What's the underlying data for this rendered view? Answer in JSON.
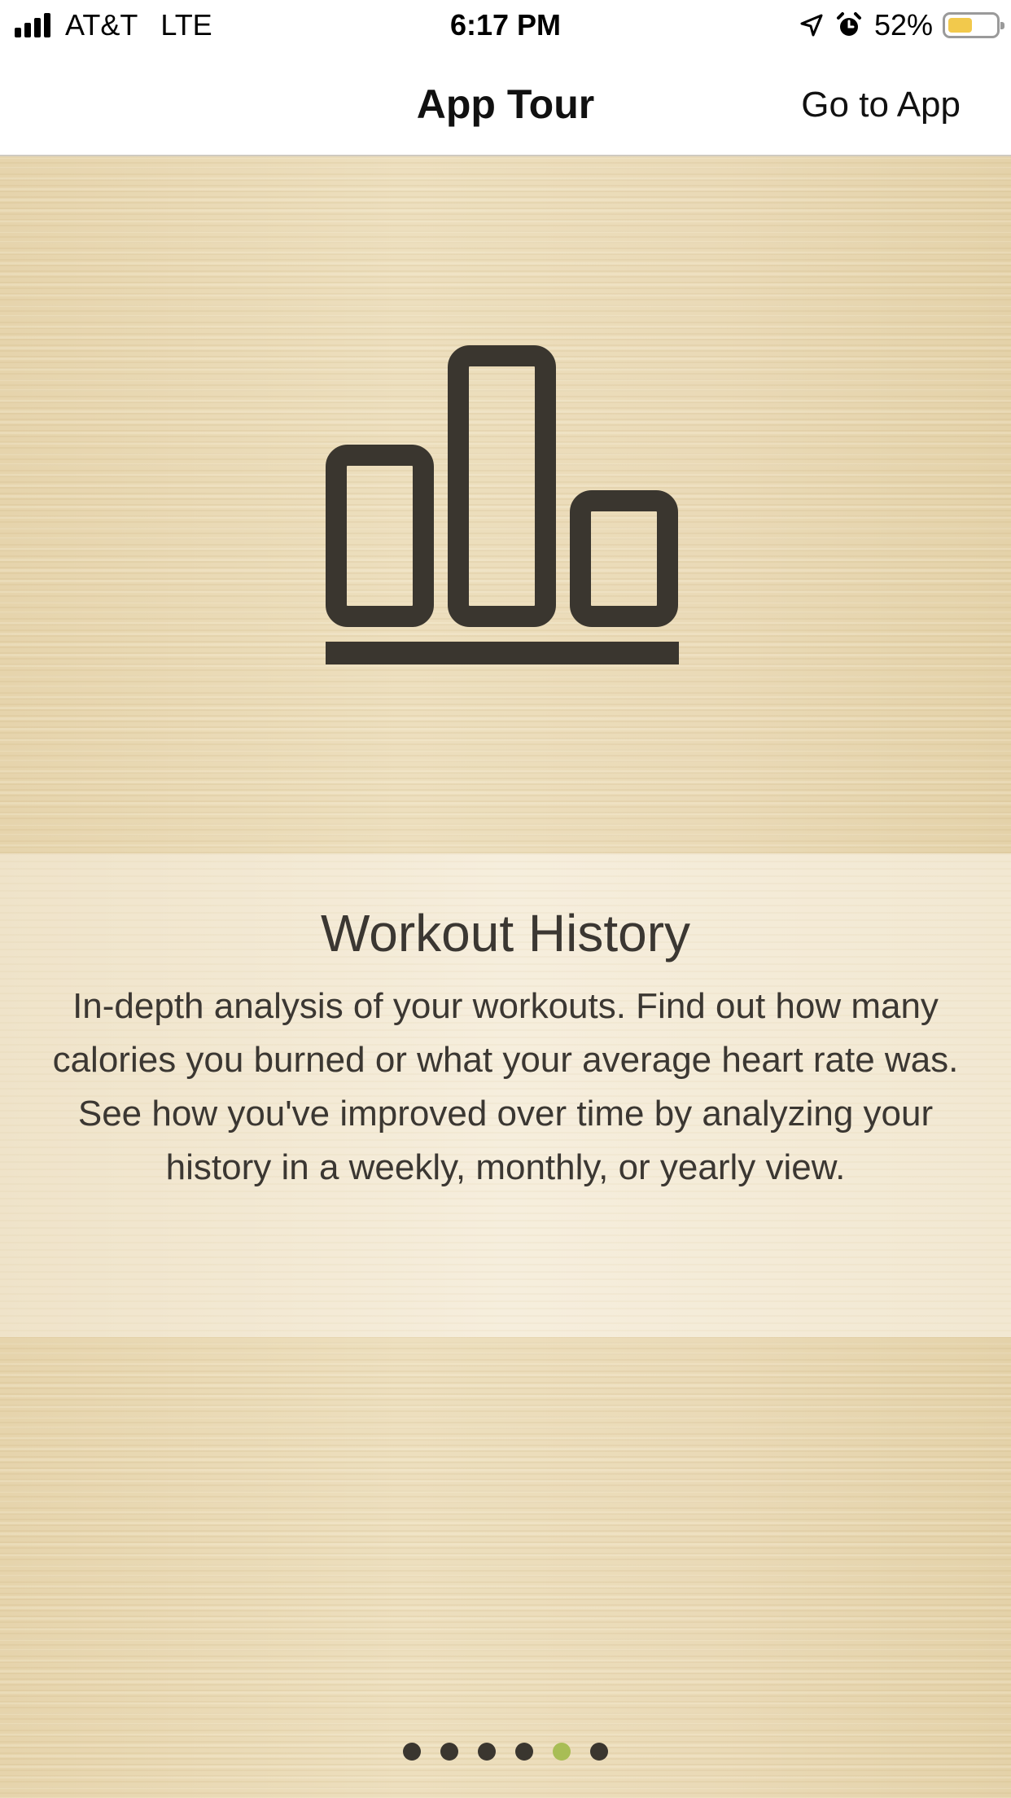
{
  "status_bar": {
    "carrier": "AT&T",
    "network": "LTE",
    "time": "6:17 PM",
    "battery_percent": "52%",
    "battery_level": 0.52,
    "battery_color": "#f2c94c"
  },
  "nav": {
    "title": "App Tour",
    "go_to_app_label": "Go to App"
  },
  "hero": {
    "icon": "bar-chart-icon"
  },
  "card": {
    "title": "Workout History",
    "body": "In-depth analysis of your workouts. Find out how many calories you burned or what your average heart rate was. See how you've improved over time by analyzing your history in a weekly, monthly, or yearly view."
  },
  "pagination": {
    "total": 6,
    "current": 5,
    "active_color": "#a8bd55",
    "inactive_color": "#3a362f"
  }
}
